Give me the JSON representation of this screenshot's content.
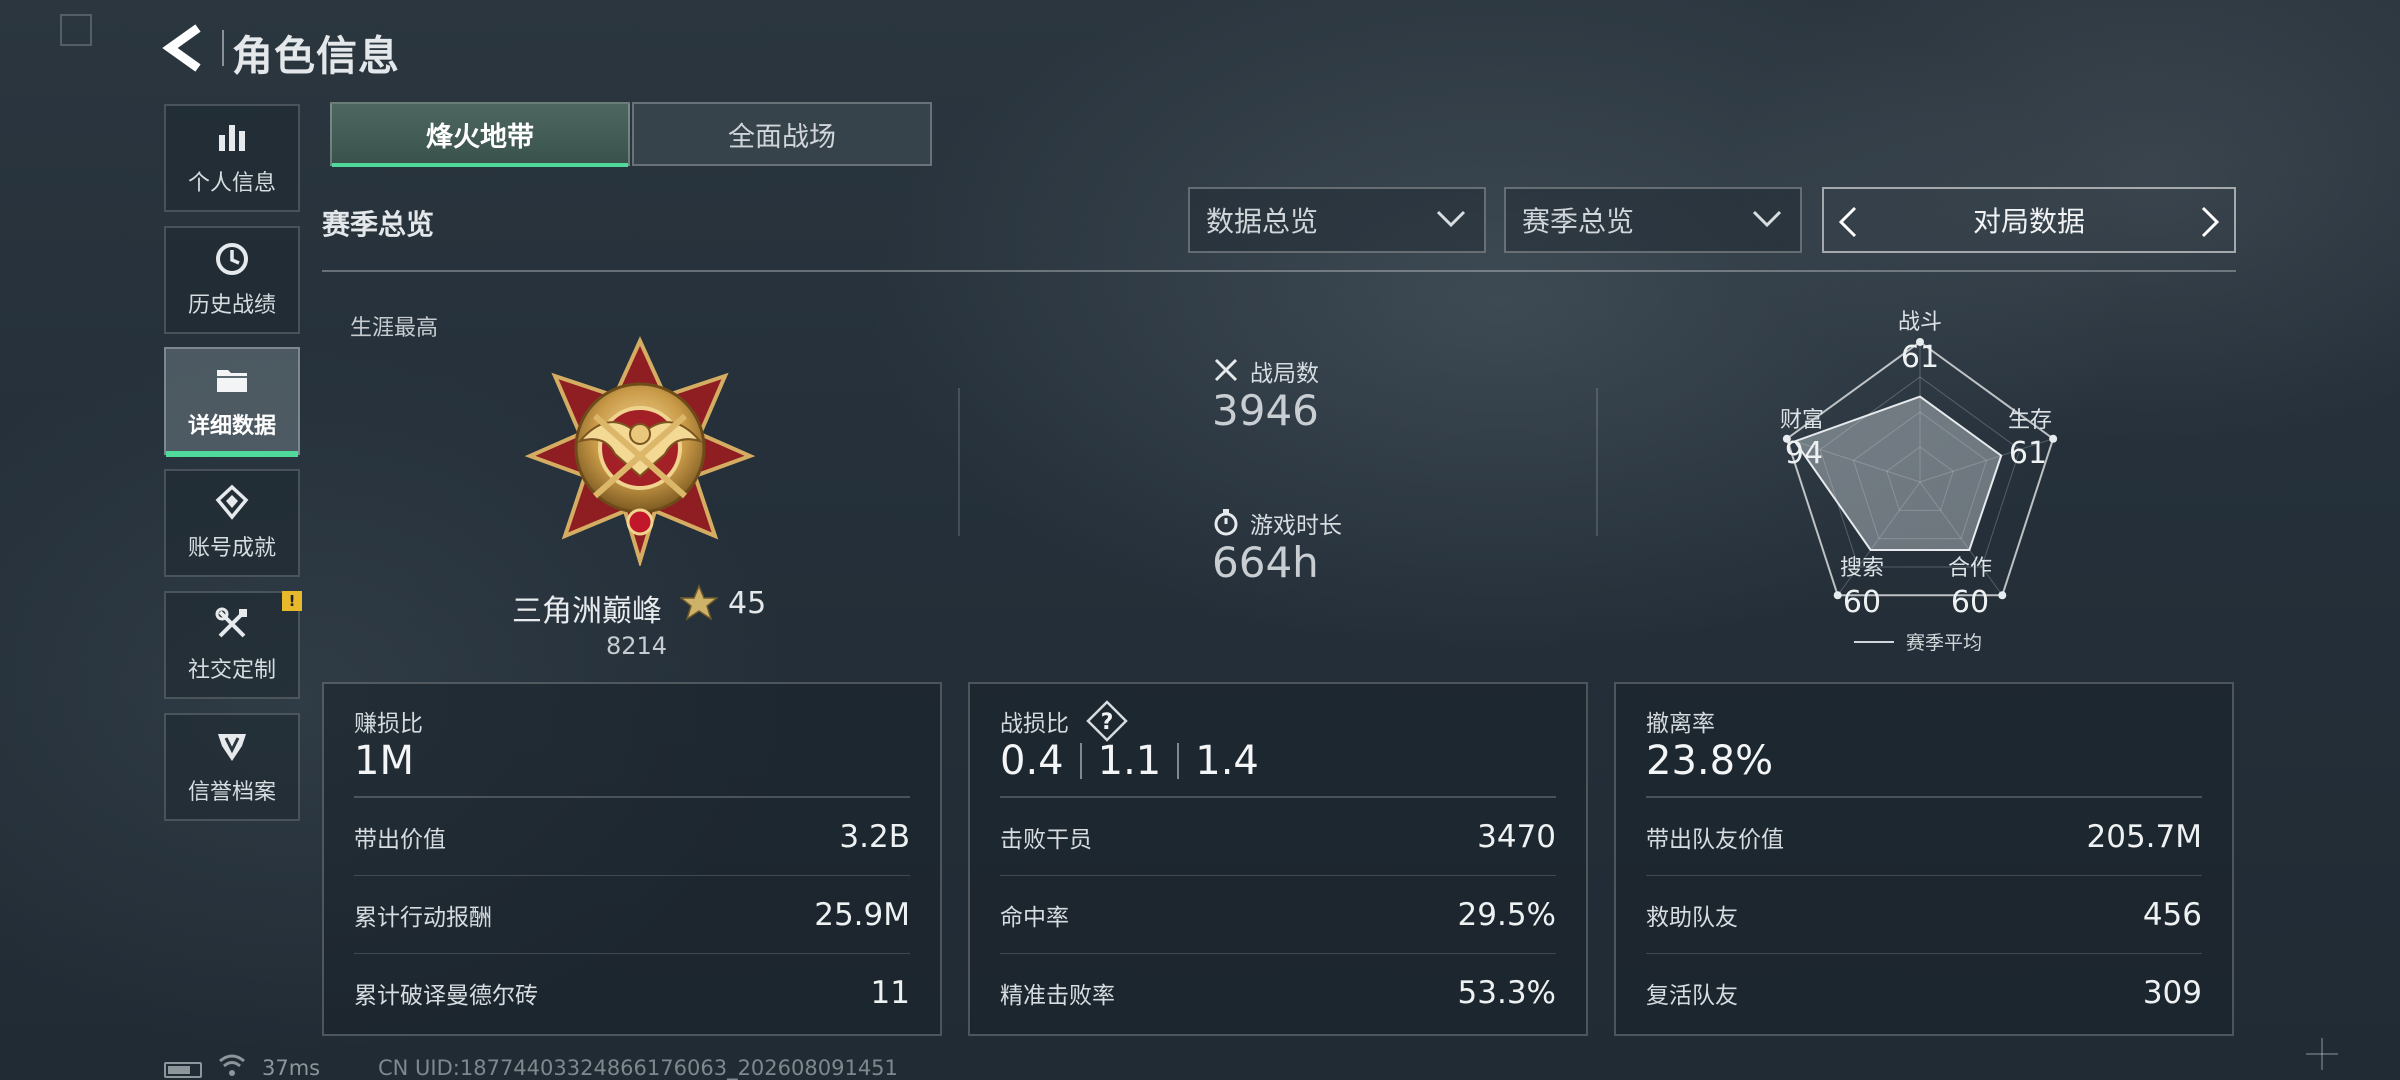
{
  "header": {
    "title": "角色信息"
  },
  "sidebar": {
    "items": [
      {
        "label": "个人信息",
        "icon": "bar-chart-icon",
        "active": false
      },
      {
        "label": "历史战绩",
        "icon": "clock-icon",
        "active": false
      },
      {
        "label": "详细数据",
        "icon": "folder-icon",
        "active": true
      },
      {
        "label": "账号成就",
        "icon": "achievement-icon",
        "active": false
      },
      {
        "label": "社交定制",
        "icon": "tools-icon",
        "active": false,
        "badge": "!"
      },
      {
        "label": "信誉档案",
        "icon": "shield-icon",
        "active": false
      }
    ]
  },
  "mode_tabs": [
    {
      "label": "烽火地带",
      "active": true
    },
    {
      "label": "全面战场",
      "active": false
    }
  ],
  "section": {
    "title": "赛季总览"
  },
  "filters": {
    "dropdown1": "数据总览",
    "dropdown2": "赛季总览",
    "pager_label": "对局数据"
  },
  "overview": {
    "career_label": "生涯最高",
    "rank_name": "三角洲巅峰",
    "stars": "45",
    "score": "8214",
    "matches_label": "战局数",
    "matches_value": "3946",
    "playtime_label": "游戏时长",
    "playtime_value": "664h"
  },
  "radar": {
    "axes": [
      {
        "label": "战斗",
        "value": 61
      },
      {
        "label": "生存",
        "value": 61
      },
      {
        "label": "合作",
        "value": 60
      },
      {
        "label": "搜索",
        "value": 60
      },
      {
        "label": "财富",
        "value": 94
      }
    ],
    "max": 100,
    "legend": "赛季平均"
  },
  "cards": {
    "profit": {
      "label": "赚损比",
      "value": "1M",
      "rows": [
        {
          "k": "带出价值",
          "v": "3.2B"
        },
        {
          "k": "累计行动报酬",
          "v": "25.9M"
        },
        {
          "k": "累计破译曼德尔砖",
          "v": "11"
        }
      ]
    },
    "kd": {
      "label": "战损比",
      "help": "?",
      "values": [
        "0.4",
        "1.1",
        "1.4"
      ],
      "rows": [
        {
          "k": "击败干员",
          "v": "3470"
        },
        {
          "k": "命中率",
          "v": "29.5%"
        },
        {
          "k": "精准击败率",
          "v": "53.3%"
        }
      ]
    },
    "extract": {
      "label": "撤离率",
      "value": "23.8%",
      "rows": [
        {
          "k": "带出队友价值",
          "v": "205.7M"
        },
        {
          "k": "救助队友",
          "v": "456"
        },
        {
          "k": "复活队友",
          "v": "309"
        }
      ]
    }
  },
  "footer": {
    "ping": "37ms",
    "uid": "CN UID:18774403324866176063_202608091451"
  },
  "colors": {
    "accent": "#4fd99b",
    "badge": "#e8b92a"
  }
}
